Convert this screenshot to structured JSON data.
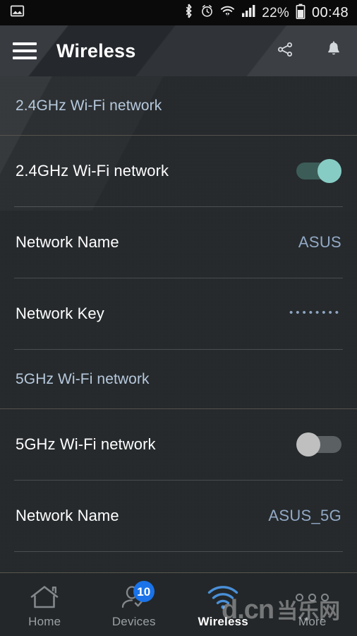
{
  "status_bar": {
    "left_icons": [
      "image-icon"
    ],
    "right_icons": [
      "bluetooth-icon",
      "alarm-icon",
      "wifi-icon",
      "signal-icon",
      "battery-icon"
    ],
    "battery_percent": "22%",
    "clock": "00:48"
  },
  "app_bar": {
    "menu_icon": "hamburger-menu-icon",
    "title": "Wireless",
    "share_icon": "share-icon",
    "notification_icon": "bell-icon"
  },
  "sections": [
    {
      "header": "2.4GHz Wi-Fi network",
      "rows": [
        {
          "type": "toggle",
          "label": "2.4GHz Wi-Fi network",
          "state": "on"
        },
        {
          "type": "value",
          "label": "Network Name",
          "value": "ASUS"
        },
        {
          "type": "masked",
          "label": "Network Key",
          "value": "••••••••"
        }
      ]
    },
    {
      "header": "5GHz Wi-Fi network",
      "rows": [
        {
          "type": "toggle",
          "label": "5GHz Wi-Fi network",
          "state": "off"
        },
        {
          "type": "value",
          "label": "Network Name",
          "value": "ASUS_5G"
        }
      ]
    }
  ],
  "bottom_nav": {
    "items": [
      {
        "label": "Home",
        "icon": "home-icon",
        "active": false,
        "badge": null
      },
      {
        "label": "Devices",
        "icon": "devices-icon",
        "active": false,
        "badge": "10"
      },
      {
        "label": "Wireless",
        "icon": "wifi-icon",
        "active": true,
        "badge": null
      },
      {
        "label": "More",
        "icon": "more-dots-icon",
        "active": false,
        "badge": null
      }
    ]
  },
  "watermark": {
    "en": "d.cn",
    "cn": "当乐网"
  },
  "colors": {
    "accent_blue": "#1a73e8",
    "wifi_blue": "#4a90d9",
    "toggle_on_thumb": "#86ccc4",
    "toggle_on_track": "#3c5c58",
    "toggle_off_thumb": "#bfbfbf",
    "toggle_off_track": "#5b6063",
    "section_header_text": "#b7c9dd",
    "value_text": "#92a9c6",
    "background": "#23272a"
  }
}
